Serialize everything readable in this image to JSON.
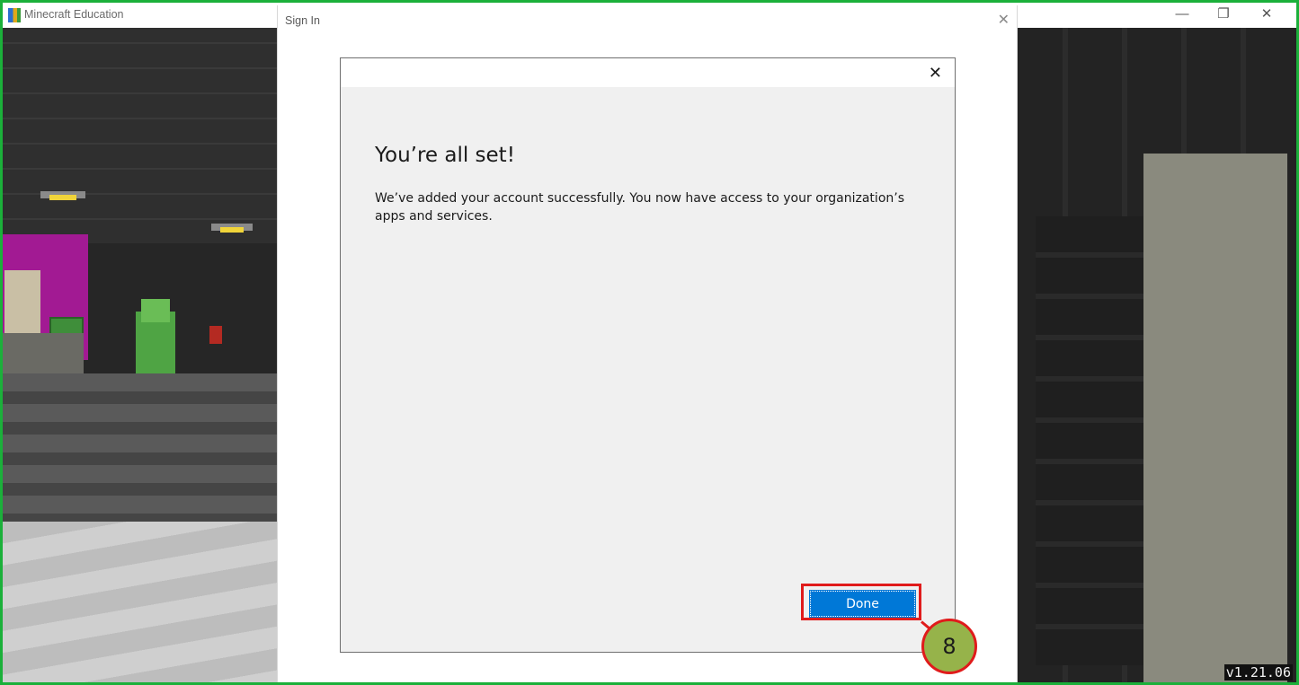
{
  "game_window": {
    "title": "Minecraft Education",
    "icon": "minecraft-education-logo",
    "controls": {
      "minimize": "—",
      "maximize": "❐",
      "close": "✕"
    },
    "version": "v1.21.06"
  },
  "signin_window": {
    "title": "Sign In",
    "close_glyph": "✕"
  },
  "dialog": {
    "close_glyph": "✕",
    "heading": "You’re all set!",
    "message": "We’ve added your account successfully. You now have access to your organization’s apps and services.",
    "done_label": "Done"
  },
  "annotation": {
    "step_number": "8",
    "highlight_color": "#e01b1b",
    "badge_color": "#96b34a"
  },
  "colors": {
    "frame_border": "#1bb03a",
    "primary_button": "#0078d7"
  }
}
